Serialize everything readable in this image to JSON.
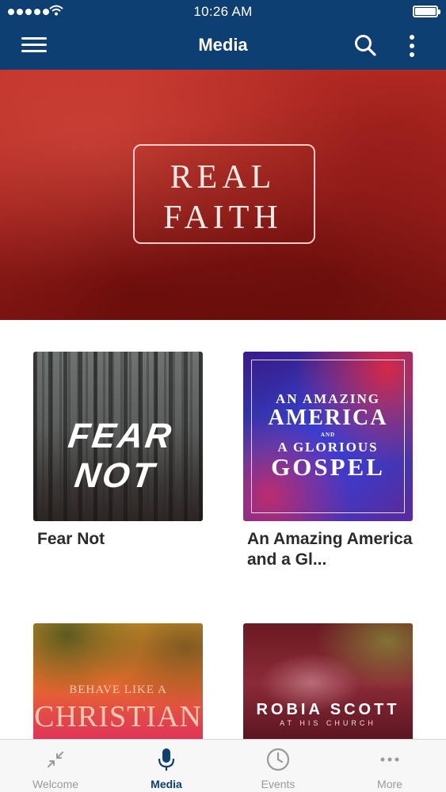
{
  "status_bar": {
    "time": "10:26 AM"
  },
  "header": {
    "title": "Media"
  },
  "hero": {
    "line1": "REAL",
    "line2": "FAITH"
  },
  "cards": [
    {
      "title": "Fear Not",
      "art_text": [
        "FEAR NOT"
      ]
    },
    {
      "title": "An Amazing America and a Gl...",
      "art_text": [
        "AN AMAZING",
        "AMERICA",
        "AND",
        "A GLORIOUS",
        "GOSPEL"
      ]
    },
    {
      "title": "",
      "art_text": [
        "BEHAVE LIKE A",
        "CHRISTIAN"
      ]
    },
    {
      "title": "",
      "art_text": [
        "ROBIA SCOTT",
        "AT HIS CHURCH"
      ]
    }
  ],
  "tabs": [
    {
      "label": "Welcome",
      "icon": "collapse-arrows-icon"
    },
    {
      "label": "Media",
      "icon": "microphone-icon",
      "active": true
    },
    {
      "label": "Events",
      "icon": "clock-icon"
    },
    {
      "label": "More",
      "icon": "more-dots-icon"
    }
  ],
  "colors": {
    "nav_bar": "#0d3f73",
    "active_tab": "#0d3f73",
    "inactive_tab": "#9a9a9a",
    "hero": "#b02a23"
  }
}
